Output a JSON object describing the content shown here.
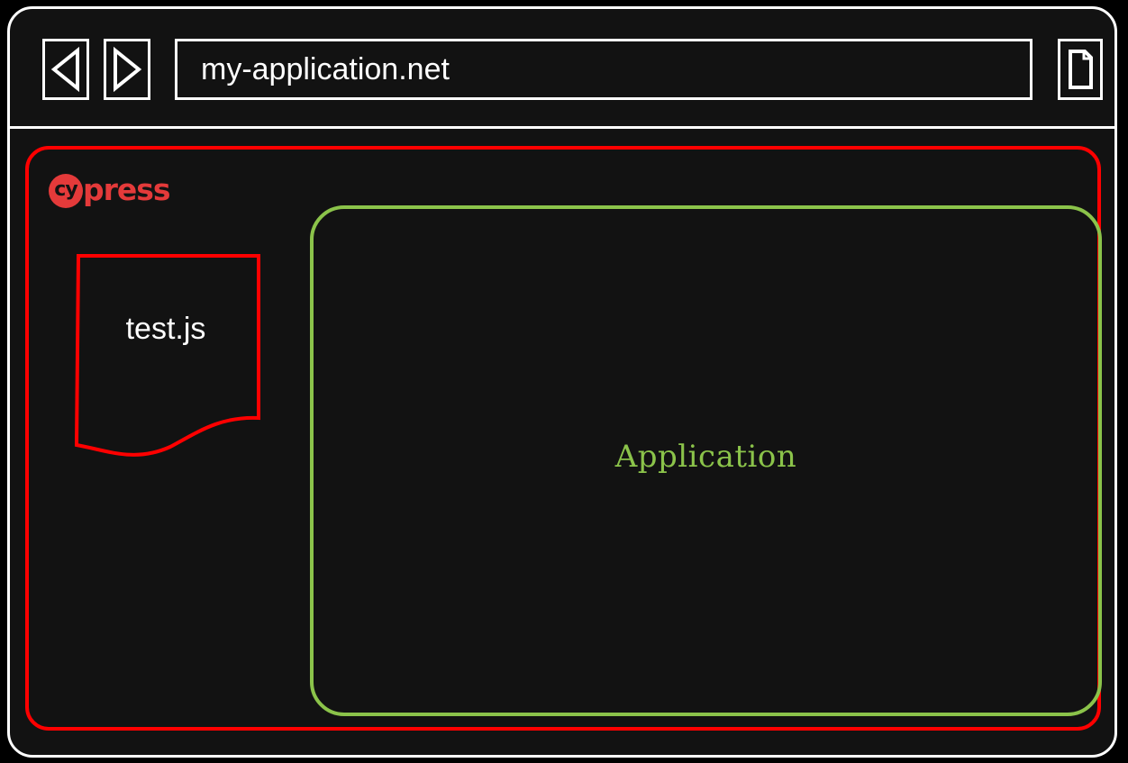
{
  "browser": {
    "url": "my-application.net",
    "back_icon": "triangle-left-icon",
    "forward_icon": "triangle-right-icon",
    "page_icon": "document-icon"
  },
  "runner": {
    "logo_prefix": "cy",
    "logo_suffix": "press",
    "test_file": "test.js",
    "app_label": "Application"
  },
  "colors": {
    "background": "#121212",
    "outline": "#ffffff",
    "runner_border": "#ff0000",
    "cypress_brand": "#e43a3a",
    "application": "#8bc34a"
  }
}
